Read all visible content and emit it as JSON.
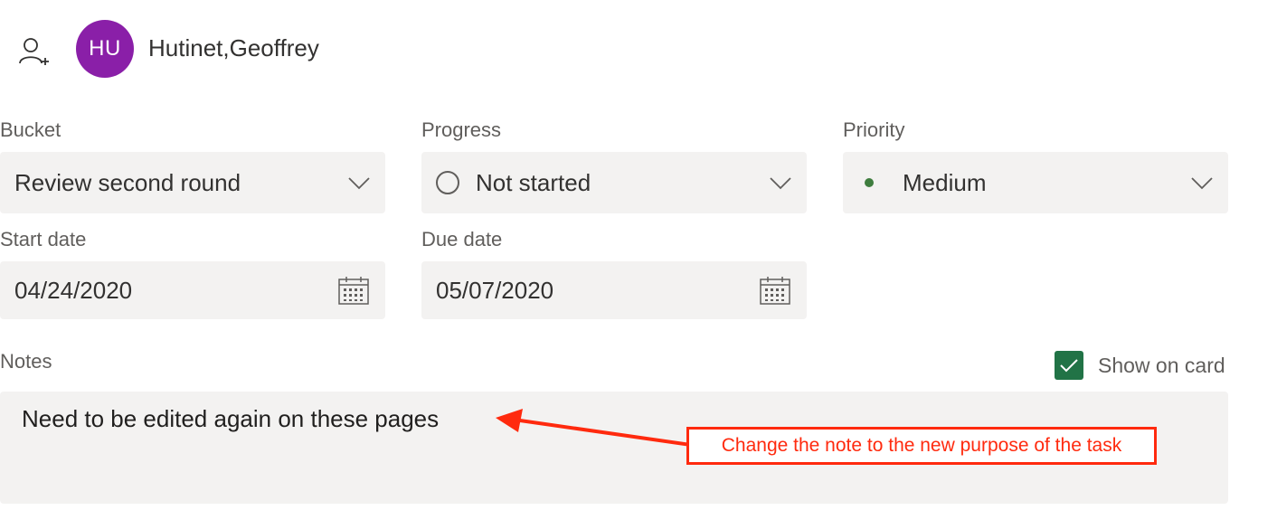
{
  "assignee": {
    "initials": "HU",
    "name": "Hutinet,Geoffrey",
    "avatar_color": "#8a1fa8"
  },
  "bucket": {
    "label": "Bucket",
    "value": "Review second round"
  },
  "progress": {
    "label": "Progress",
    "value": "Not started"
  },
  "priority": {
    "label": "Priority",
    "value": "Medium",
    "dot_color": "#3e7d3e"
  },
  "start_date": {
    "label": "Start date",
    "value": "04/24/2020"
  },
  "due_date": {
    "label": "Due date",
    "value": "05/07/2020"
  },
  "notes": {
    "label": "Notes",
    "value": "Need to be edited again on these pages",
    "show_on_card_label": "Show on card",
    "show_on_card_checked": true
  },
  "annotation": {
    "text": "Change the note to the new purpose of the task",
    "color": "#ff2a0e"
  },
  "icons": [
    "add-assignee-icon",
    "chevron-down-icon",
    "calendar-icon",
    "checkmark-icon",
    "not-started-circle-icon"
  ]
}
